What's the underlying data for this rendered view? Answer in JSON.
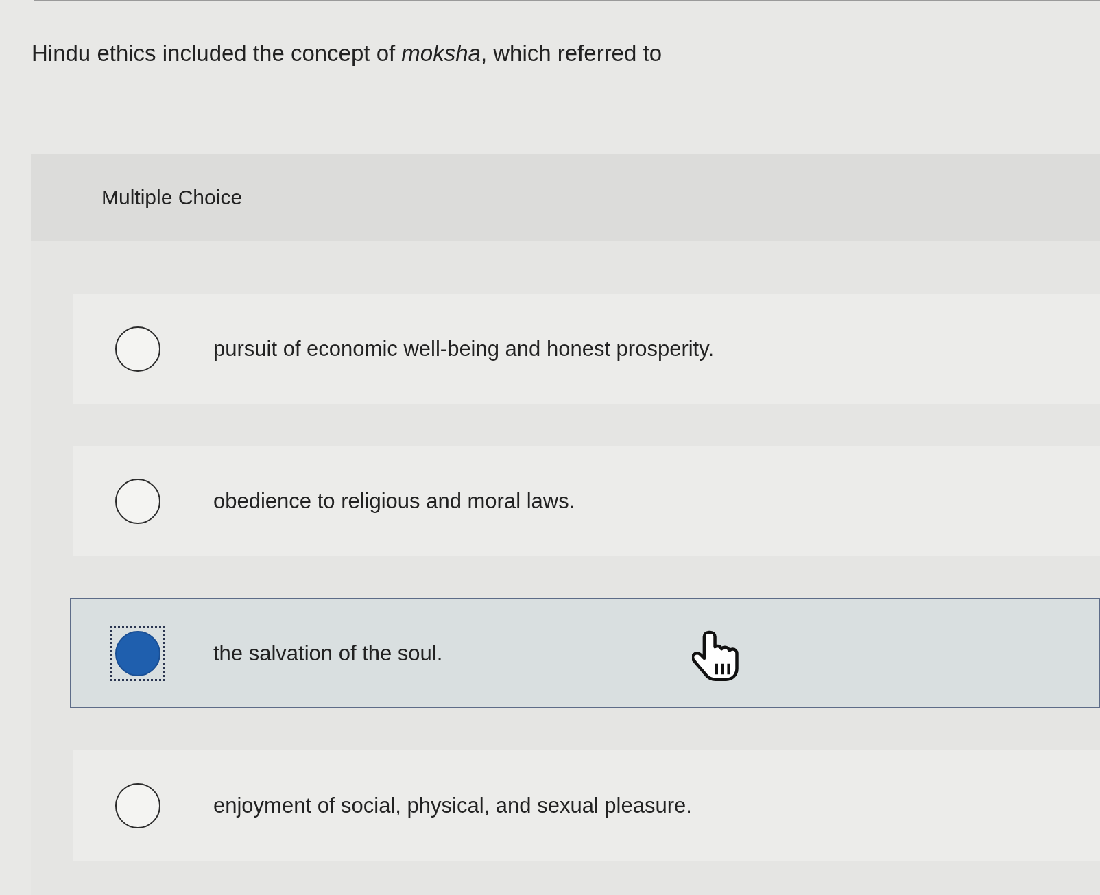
{
  "question": "Hindu ethics included the concept of *moksha*, which referred to",
  "question_type": "Multiple Choice",
  "options": [
    {
      "label": "pursuit of economic well-being and honest prosperity.",
      "selected": false,
      "focused": false
    },
    {
      "label": "obedience to religious and moral laws.",
      "selected": false,
      "focused": false
    },
    {
      "label": "the salvation of the soul.",
      "selected": true,
      "focused": true
    },
    {
      "label": "enjoyment of social, physical, and sexual pleasure.",
      "selected": false,
      "focused": false
    }
  ]
}
